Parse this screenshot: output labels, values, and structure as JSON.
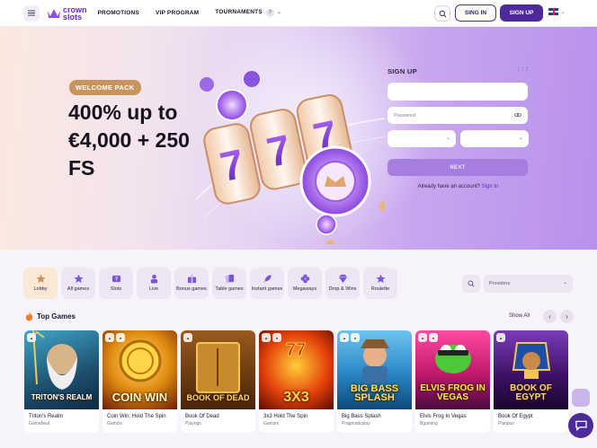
{
  "header": {
    "logo_line1": "crown",
    "logo_line2": "slots",
    "nav": [
      "PROMOTIONS",
      "VIP PROGRAM",
      "TOURNAMENTS"
    ],
    "tournaments_badge": "?",
    "signin_label": "SING IN",
    "signup_label": "SIGN UP"
  },
  "hero": {
    "badge": "WELCOME PACK",
    "offer": "400% up to €4,000 + 250 FS"
  },
  "signup_form": {
    "title": "SIGN UP",
    "step": "1 / 3",
    "email_placeholder": "",
    "password_placeholder": "Password",
    "next_label": "NEXT",
    "already_text": "Already have an account?",
    "signin_link": "Sign In"
  },
  "categories": [
    {
      "label": "Lobby",
      "icon": "star-icon",
      "active": true
    },
    {
      "label": "All games",
      "icon": "star-icon"
    },
    {
      "label": "Slots",
      "icon": "slots-icon"
    },
    {
      "label": "Live",
      "icon": "live-dealer-icon"
    },
    {
      "label": "Bonus games",
      "icon": "bonus-icon"
    },
    {
      "label": "Table games",
      "icon": "cards-icon"
    },
    {
      "label": "Instant games",
      "icon": "rocket-icon"
    },
    {
      "label": "Megaways",
      "icon": "clover-icon"
    },
    {
      "label": "Drop & Wins",
      "icon": "gem-icon"
    },
    {
      "label": "Roulette",
      "icon": "star-icon"
    }
  ],
  "providers_placeholder": "Providers",
  "top_games": {
    "title": "Top Games",
    "show_all": "Show All",
    "games": [
      {
        "name": "Triton's Realm",
        "provider": "Gamebeat",
        "art": "TRITON'S REALM"
      },
      {
        "name": "Coin Win: Hold The Spin",
        "provider": "Gamzix",
        "art": "COIN WIN"
      },
      {
        "name": "Book Of Dead",
        "provider": "Playngo",
        "art": "BOOK OF DEAD"
      },
      {
        "name": "3x3 Hold The Spin",
        "provider": "Gamzix",
        "art": "3X3"
      },
      {
        "name": "Big Bass Splash",
        "provider": "Pragmaticplay",
        "art": "BIG BASS SPLASH"
      },
      {
        "name": "Elvis Frog In Vegas",
        "provider": "Bgaming",
        "art": "ELVIS FROG IN VEGAS"
      },
      {
        "name": "Book Of Egypt",
        "provider": "Platipus",
        "art": "BOOK OF EGYPT"
      }
    ]
  },
  "colors": {
    "brand": "#4c2a9a",
    "accent": "#c9935c",
    "hero_purple": "#b891ec"
  }
}
